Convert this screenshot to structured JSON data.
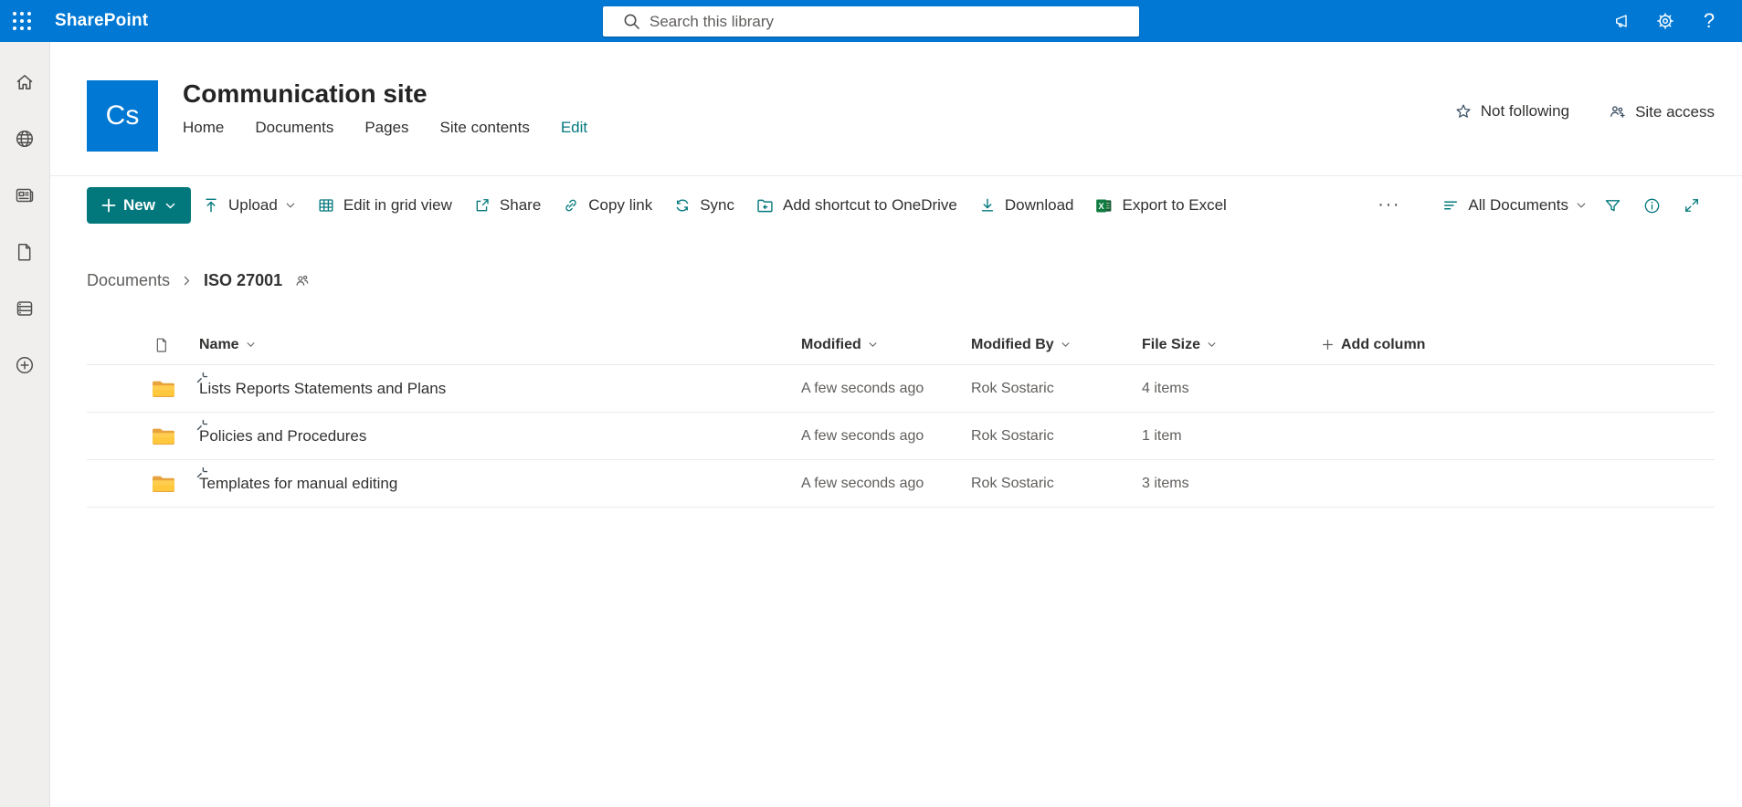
{
  "topbar": {
    "app_name": "SharePoint",
    "search_placeholder": "Search this library"
  },
  "colors": {
    "suite_blue": "#0078d4",
    "theme_teal": "#03787c",
    "folder_yellow": "#ffb900",
    "excel_green": "#107c41",
    "text_dark": "#323130",
    "text_muted": "#605e5c"
  },
  "site": {
    "logo_text": "Cs",
    "title": "Communication site",
    "nav": [
      {
        "label": "Home"
      },
      {
        "label": "Documents"
      },
      {
        "label": "Pages"
      },
      {
        "label": "Site contents"
      },
      {
        "label": "Edit"
      }
    ],
    "follow_label": "Not following",
    "access_label": "Site access"
  },
  "commandbar": {
    "new_label": "New",
    "items": [
      {
        "label": "Upload"
      },
      {
        "label": "Edit in grid view"
      },
      {
        "label": "Share"
      },
      {
        "label": "Copy link"
      },
      {
        "label": "Sync"
      },
      {
        "label": "Add shortcut to OneDrive"
      },
      {
        "label": "Download"
      },
      {
        "label": "Export to Excel"
      }
    ],
    "view_label": "All Documents"
  },
  "breadcrumb": {
    "parent": "Documents",
    "current": "ISO 27001"
  },
  "table": {
    "columns": {
      "name": "Name",
      "modified": "Modified",
      "modified_by": "Modified By",
      "file_size": "File Size"
    },
    "add_column": "Add column",
    "rows": [
      {
        "name": "Lists Reports Statements and Plans",
        "modified": "A few seconds ago",
        "modified_by": "Rok Sostaric",
        "file_size": "4 items"
      },
      {
        "name": "Policies and Procedures",
        "modified": "A few seconds ago",
        "modified_by": "Rok Sostaric",
        "file_size": "1 item"
      },
      {
        "name": "Templates for manual editing",
        "modified": "A few seconds ago",
        "modified_by": "Rok Sostaric",
        "file_size": "3 items"
      }
    ]
  }
}
